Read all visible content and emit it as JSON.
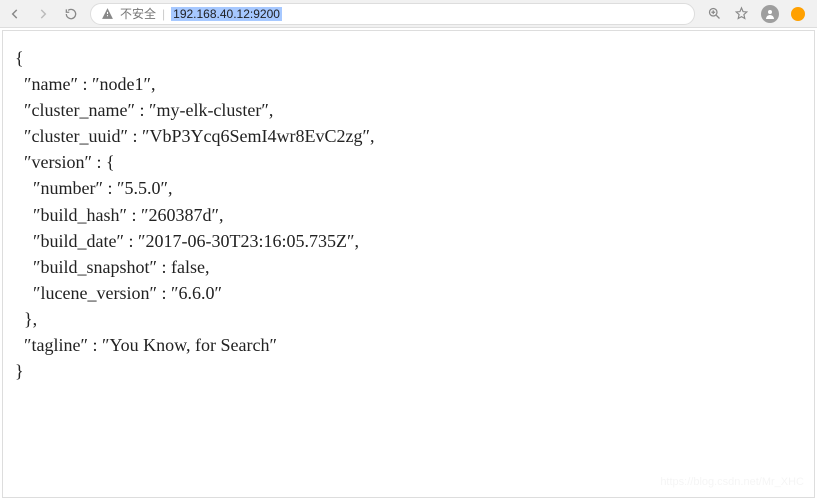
{
  "addressBar": {
    "insecure_label": "不安全",
    "url": "192.168.40.12:9200"
  },
  "json": {
    "name": "node1",
    "cluster_name": "my-elk-cluster",
    "cluster_uuid": "VbP3Ycq6SemI4wr8EvC2zg",
    "version": {
      "number": "5.5.0",
      "build_hash": "260387d",
      "build_date": "2017-06-30T23:16:05.735Z",
      "build_snapshot_label": "build_snapshot",
      "build_snapshot_value": "false",
      "lucene_version": "6.6.0"
    },
    "tagline": "You Know, for Search"
  },
  "watermark": "https://blog.csdn.net/Mr_XHC"
}
